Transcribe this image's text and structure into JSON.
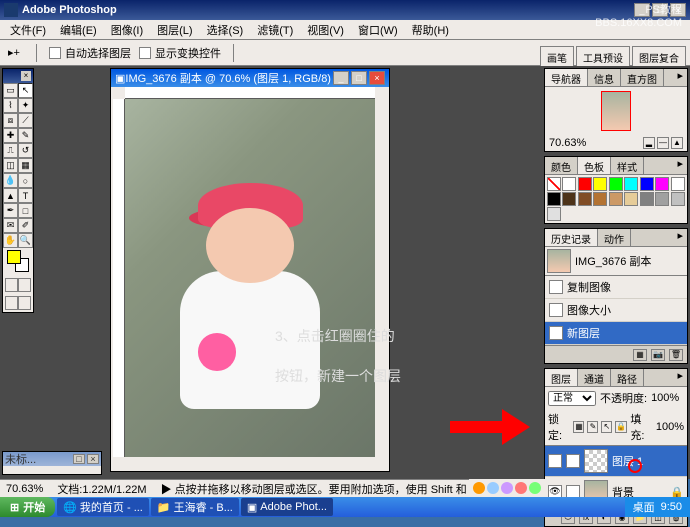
{
  "app": {
    "title": "Adobe Photoshop",
    "watermark_line1": "PS教程",
    "watermark_line2": "BBS.16XX8.COM"
  },
  "menu": {
    "file": "文件(F)",
    "edit": "编辑(E)",
    "image": "图像(I)",
    "layer": "图层(L)",
    "select": "选择(S)",
    "filter": "滤镜(T)",
    "view": "视图(V)",
    "window": "窗口(W)",
    "help": "帮助(H)"
  },
  "options": {
    "auto_select_layer": "自动选择图层",
    "show_bounding": "显示变换控件"
  },
  "right_toolbar": {
    "brushes": "画笔",
    "tool_presets": "工具预设",
    "layer_comps": "图层复合"
  },
  "document": {
    "title": "IMG_3676 副本 @ 70.6% (图层 1, RGB/8)"
  },
  "mini_doc": {
    "title": "未标..."
  },
  "annotation": {
    "line1": "3、点击红圈圈住的",
    "line2": "按钮，新建一个图层"
  },
  "navigator": {
    "tab1": "导航器",
    "tab2": "信息",
    "tab3": "直方图",
    "zoom": "70.63%"
  },
  "swatches": {
    "tab1": "颜色",
    "tab2": "色板",
    "tab3": "样式",
    "colors": [
      "#ffffff",
      "#ff0000",
      "#ffff00",
      "#00ff00",
      "#00ffff",
      "#0000ff",
      "#ff00ff",
      "#ffffff",
      "#000000",
      "#4d3319",
      "#804d26",
      "#b37333",
      "#cc9966",
      "#e6cc99",
      "#808080",
      "#a0a0a0",
      "#c0c0c0",
      "#e0e0e0"
    ]
  },
  "history": {
    "tab1": "历史记录",
    "tab2": "动作",
    "snapshot": "IMG_3676 副本",
    "items": [
      {
        "label": "复制图像",
        "active": false
      },
      {
        "label": "图像大小",
        "active": false
      },
      {
        "label": "新图层",
        "active": true
      }
    ]
  },
  "layers": {
    "tab1": "图层",
    "tab2": "通道",
    "tab3": "路径",
    "blend_mode": "正常",
    "opacity_label": "不透明度:",
    "opacity": "100%",
    "lock_label": "锁定:",
    "fill_label": "填充:",
    "fill": "100%",
    "items": [
      {
        "name": "图层 1",
        "selected": true,
        "checker": true
      },
      {
        "name": "背景",
        "selected": false,
        "checker": false
      }
    ]
  },
  "statusbar": {
    "zoom": "70.63%",
    "doc_size": "文档:1.22M/1.22M",
    "hint": "▶ 点按并拖移以移动图层或选区。要用附加选项，使用 Shift 和 Alt 键。"
  },
  "taskbar": {
    "start": "开始",
    "task1": "我的首页 - ...",
    "task2": "王海睿 - B...",
    "task3": "Adobe Phot...",
    "task4": "桌面",
    "time": "9:50"
  }
}
